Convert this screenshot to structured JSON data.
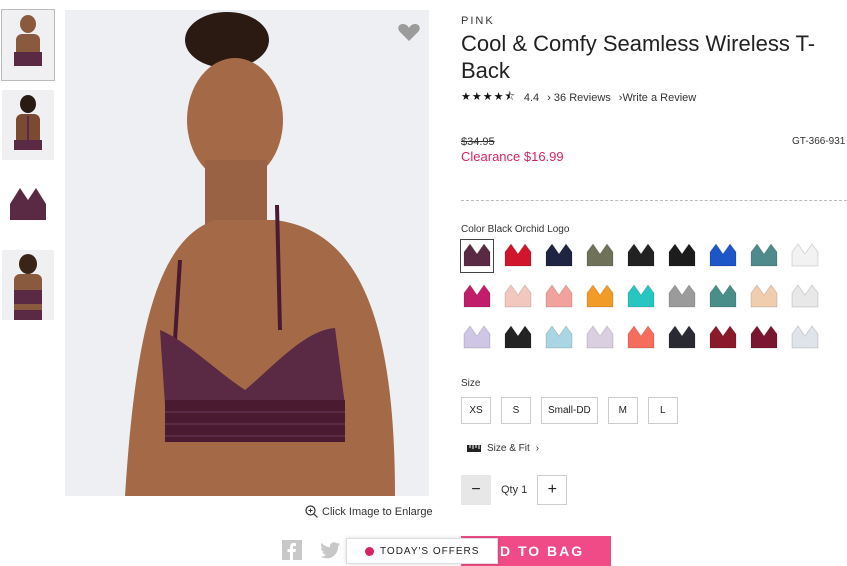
{
  "thumbnails": [
    {
      "name": "thumb-front",
      "color": "#5a2a44"
    },
    {
      "name": "thumb-back",
      "color": "#5a2a44"
    },
    {
      "name": "thumb-flat",
      "color": "#5a2a44"
    },
    {
      "name": "thumb-model",
      "color": "#5a2a44"
    }
  ],
  "product": {
    "brand": "PINK",
    "title": "Cool & Comfy Seamless Wireless T-Back",
    "rating": "4.4",
    "reviews_link": "36 Reviews",
    "write_review": "Write a Review",
    "old_price": "$34.95",
    "sale_price": "Clearance $16.99",
    "sku": "GT-366-931"
  },
  "hero": {
    "enlarge_label": "Click Image to Enlarge"
  },
  "colors": {
    "label": "Color Black Orchid Logo",
    "swatches": [
      "#5a2a44",
      "#d0152c",
      "#1f2540",
      "#6f7259",
      "#222222",
      "#1c1c1c",
      "#1d56c7",
      "#4f8a8c",
      "#f2f2f2",
      "#c21d6a",
      "#f2c7be",
      "#f1a29d",
      "#f39b27",
      "#28c6c0",
      "#9b9b9b",
      "#4a8e8a",
      "#f1cdb0",
      "#e8e8e8",
      "#cfc6e6",
      "#222222",
      "#a9d6e2",
      "#d9cfe0",
      "#f56e5d",
      "#2a2a33",
      "#8a1a2a",
      "#7a1630",
      "#dfe3ea"
    ]
  },
  "size": {
    "label": "Size",
    "options": [
      "XS",
      "S",
      "Small-DD",
      "M",
      "L"
    ],
    "fit_link": "Size & Fit"
  },
  "quantity": {
    "label": "Qty 1",
    "minus": "−",
    "plus": "+"
  },
  "cta": {
    "add_to_bag": "DD TO BAG",
    "offers": "TODAY'S OFFERS"
  },
  "accent_color": "#f04a87"
}
